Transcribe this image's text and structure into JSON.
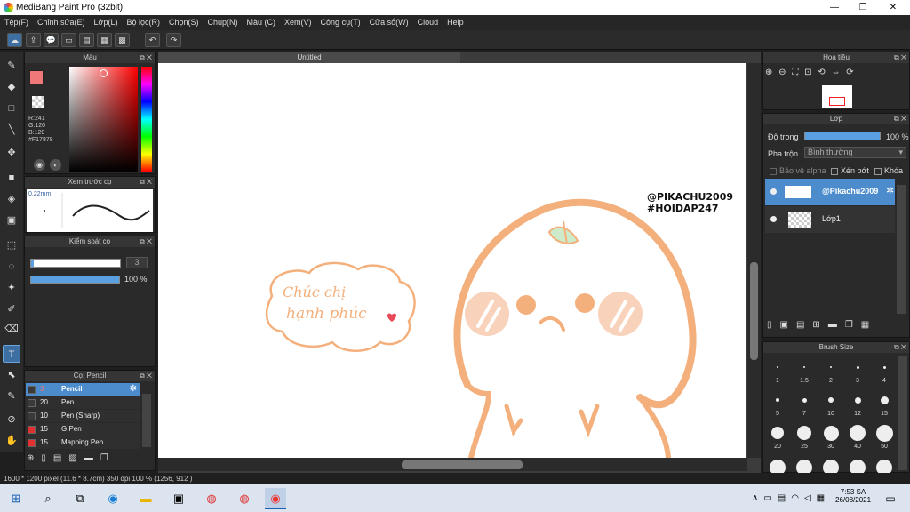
{
  "window": {
    "title": "MediBang Paint Pro (32bit)",
    "minimize": "—",
    "maximize": "❐",
    "close": "✕"
  },
  "menu": [
    "Tệp(F)",
    "Chỉnh sửa(E)",
    "Lớp(L)",
    "Bộ lọc(R)",
    "Chọn(S)",
    "Chụp(N)",
    "Màu (C)",
    "Xem(V)",
    "Công cụ(T)",
    "Cửa sổ(W)",
    "Cloud",
    "Help"
  ],
  "document": {
    "tab": "Untitled"
  },
  "color_panel": {
    "title": "Màu",
    "r": "R:241",
    "g": "G:120",
    "b": "B:120",
    "hex": "#F17878",
    "fg_color": "#F17878"
  },
  "brush_preview": {
    "title": "Xem trước cọ",
    "size": "0.22mm"
  },
  "brush_control": {
    "title": "Kiểm soát cọ",
    "size_value": "3",
    "opacity": "100 %"
  },
  "brush_list": {
    "title": "Cọ: Pencil",
    "items": [
      {
        "size": "3",
        "name": "Pencil",
        "selected": true,
        "color": "#3a3a3a"
      },
      {
        "size": "20",
        "name": "Pen",
        "selected": false,
        "color": "#3a3a3a"
      },
      {
        "size": "10",
        "name": "Pen (Sharp)",
        "selected": false,
        "color": "#3a3a3a"
      },
      {
        "size": "15",
        "name": "G Pen",
        "selected": false,
        "color": "#e03030"
      },
      {
        "size": "15",
        "name": "Mapping Pen",
        "selected": false,
        "color": "#e03030"
      }
    ]
  },
  "navigator": {
    "title": "Hoa tiêu"
  },
  "layers": {
    "title": "Lớp",
    "opacity_label": "Độ trong",
    "opacity_value": "100 %",
    "blend_label": "Pha trộn",
    "blend_value": "Bình thường",
    "protect_alpha": "Bảo vệ alpha",
    "clipping": "Xén bớt",
    "lock": "Khóa",
    "items": [
      {
        "name": "@Pikachu2009",
        "selected": true
      },
      {
        "name": "Lớp1",
        "selected": false
      }
    ]
  },
  "brush_size": {
    "title": "Brush Size",
    "rows": [
      [
        "1",
        "1.5",
        "2",
        "3",
        "4"
      ],
      [
        "5",
        "7",
        "10",
        "12",
        "15"
      ],
      [
        "20",
        "25",
        "30",
        "40",
        "50"
      ]
    ]
  },
  "artwork": {
    "watermark_line1": "@PIKACHU2009",
    "watermark_line2": "#HOIDAP247",
    "bubble_line1": "Chúc chị",
    "bubble_line2": "hạnh phúc",
    "stroke_color": "#F4B07C",
    "cheek_color": "#F8D2BA"
  },
  "status": "1600 * 1200 pixel   (11.6 * 8.7cm)   350 dpi   100 %   (1256, 912 )",
  "taskbar": {
    "time": "7:53 SA",
    "date": "26/08/2021"
  }
}
